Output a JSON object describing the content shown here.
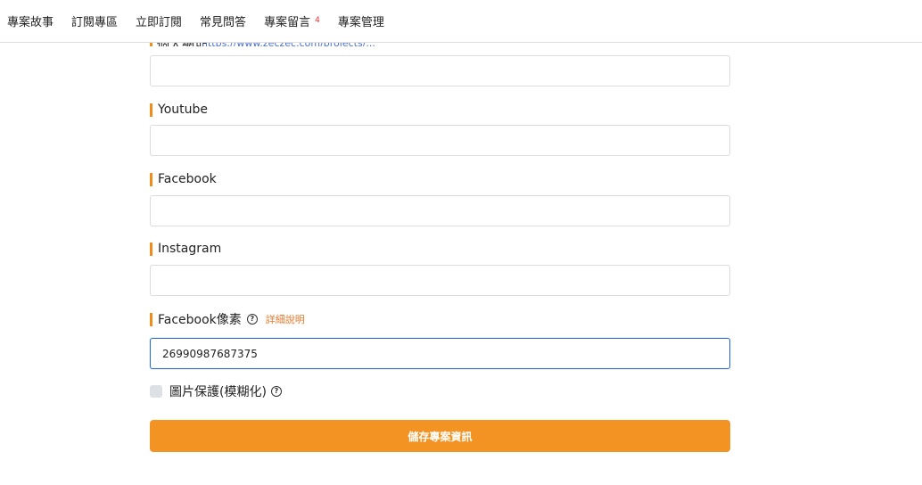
{
  "nav": {
    "items": [
      {
        "label": "專案故事"
      },
      {
        "label": "訂閱專區"
      },
      {
        "label": "立即訂閱"
      },
      {
        "label": "常見問答"
      },
      {
        "label": "專案留言",
        "badge": "4"
      },
      {
        "label": "專案管理"
      }
    ]
  },
  "form": {
    "partial_field": {
      "label": "個人網址",
      "hint": "https://www.zeczec.com/projects/..."
    },
    "partial_input_value": "",
    "youtube": {
      "label": "Youtube",
      "value": ""
    },
    "facebook": {
      "label": "Facebook",
      "value": ""
    },
    "instagram": {
      "label": "Instagram",
      "value": ""
    },
    "facebook_pixel": {
      "label": "Facebook像素",
      "help_icon": "question-circle-icon",
      "detail_link": "詳細說明",
      "value": "26990987687375"
    },
    "image_protection": {
      "label": "圖片保護(模糊化)",
      "checked": false,
      "help_icon": "question-circle-icon"
    },
    "save_label": "儲存專案資訊"
  },
  "colors": {
    "accent": "#f39324",
    "label_bar": "#f08c1a",
    "link_orange": "#e8782a",
    "focus_border": "#2a6bd3",
    "badge": "#e03a3a"
  }
}
